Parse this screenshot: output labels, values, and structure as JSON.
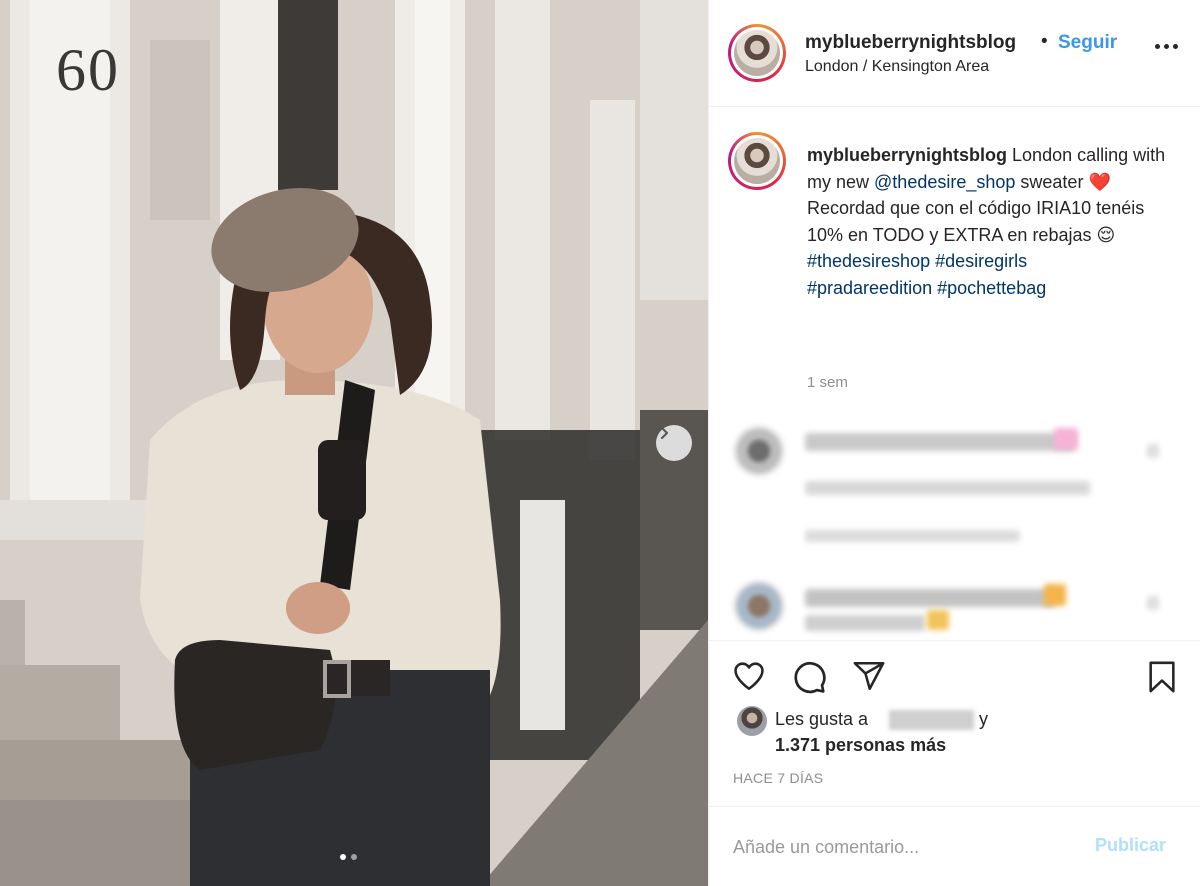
{
  "post": {
    "username": "myblueberrynightsblog",
    "separator": "•",
    "follow_label": "Seguir",
    "location": "London / Kensington Area",
    "more_icon": "more-horizontal-icon"
  },
  "photo": {
    "door_number": "60",
    "next_icon": "chevron-right-icon",
    "slide_count": 2,
    "active_slide": 1
  },
  "caption": {
    "username": "myblueberrynightsblog",
    "text_1": " London calling with my new ",
    "mention": "@thedesire_shop",
    "text_2": " sweater ",
    "heart_emoji": "❤️",
    "line_2": "Recordad que con el código IRIA10 tenéis 10% en TODO y EXTRA en rebajas ",
    "smile_emoji": "😌",
    "hashtag_1": "#thedesireshop",
    "hashtag_2": "#desiregirls",
    "hashtag_3": "#pradareedition",
    "hashtag_4": "#pochettebag",
    "time": "1 sem"
  },
  "actions": {
    "like_icon": "heart-icon",
    "comment_icon": "comment-icon",
    "share_icon": "send-icon",
    "save_icon": "bookmark-icon"
  },
  "likes": {
    "prefix": "Les gusta a",
    "suffix": "y",
    "count_text": "1.371 personas más"
  },
  "post_age": "HACE 7 DÍAS",
  "comment_box": {
    "placeholder": "Añade un comentario...",
    "publish_label": "Publicar"
  },
  "colors": {
    "link_blue": "#3897f0",
    "publish_disabled": "#b2dffc",
    "mention_blue": "#003569"
  }
}
